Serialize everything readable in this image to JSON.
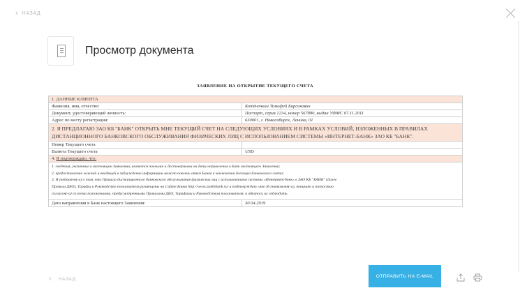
{
  "nav": {
    "back_label": "НАЗАД",
    "back_icon": "chevron-left-icon",
    "close_icon": "close-icon"
  },
  "header": {
    "title": "Просмотр документа",
    "icon": "document-icon"
  },
  "document": {
    "title": "ЗАЯВЛЕНИЕ НА ОТКРЫТИЕ ТЕКУЩЕГО СЧЕТА",
    "section1": "1. ДАННЫЕ КЛИЕНТА",
    "rows1": [
      {
        "label": "Фамилия, имя, отчество:",
        "value": "Котёночкин Тимофей Барсикович"
      },
      {
        "label": "Документ, удостоверяющий личность:",
        "value": "Паспорт, серия 1234, номер 567890, выдан УФМС 07.11.2011"
      },
      {
        "label": "Адрес по месту регистрации:",
        "value": "630001, г. Новосибирск, Ленина, 01"
      }
    ],
    "section2_line1": "2. Я ПРЕДЛАГАЮ ЗАО КБ \"БАНК\" ОТКРЫТЬ МНЕ ТЕКУЩИЙ СЧЕТ НА СЛЕДУЮЩИХ УСЛОВИЯХ И В РАМКАХ УСЛОВИЙ, ИЗЛОЖЕННЫХ В ПРАВИЛАХ",
    "section2_line2": "ДИСТАНЦИОННОГО БАНКОВСКОГО ОБСЛУЖИВАНИЯ ФИЗИЧЕСКИХ ЛИЦ С ИСПОЛЬЗОВАНИЕМ СИСТЕМЫ «ИНТЕРНЕТ-БАНК» ЗАО КБ \"БАНК\".",
    "rows2": [
      {
        "label": "Номер Текущего счета",
        "value": ""
      },
      {
        "label": "Валюта Текущего счета",
        "value": "USD"
      }
    ],
    "section4_prefix": "4. ",
    "section4_label": "Я подтверждаю, что:",
    "notes": [
      "1. сведения, указанные в настоящем Заявлении, являются полными и достоверными на дату направления в Банк настоящего Заявления;",
      "2. предоставление ложной и вводящей в заблуждение информации может повлечь отказ Банка в заключении договора банковского счета;",
      "3. Я уведомлен(-а) о том, что Правила дистанционного банковского обслуживания физических лиц с использованием системы «Интернет-банк» в ЗАО КБ \"БАНК\" (далее",
      "Правила ДБО), Тарифы и Руководство пользователя размещены на Сайте Банка http://www.zaokbbank.ru/ и подтверждаю, что Я ознакомлен(-а), понимаю и полностью",
      "согласен(-а) со всеми положениями, предусмотренными Правилами ДБО, Тарифами и Руководством пользователя, и обязуюсь их соблюдать."
    ],
    "date_label": "Дата направления в Банк настоящего Заявления:",
    "date_value": "30.04.2019"
  },
  "footer": {
    "back_label": "НАЗАД",
    "send_label": "ОТПРАВИТЬ НА E-MAIL",
    "share_icon": "share-icon",
    "print_icon": "printer-icon"
  },
  "colors": {
    "accent": "#37b0e6",
    "section_bg": "#fbe3d8",
    "border": "#cfcfcf",
    "muted": "#b9b9b9"
  }
}
